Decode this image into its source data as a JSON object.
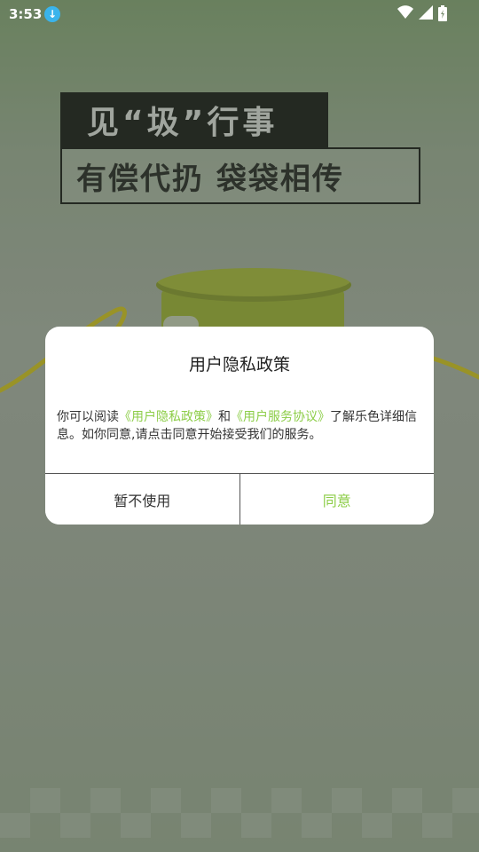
{
  "status_bar": {
    "time": "3:53"
  },
  "background": {
    "slogan_line1": "见“圾”行事",
    "slogan_line2": "有偿代扔 袋袋相传"
  },
  "dialog": {
    "title": "用户隐私政策",
    "body_prefix": "你可以阅读",
    "privacy_link": "《用户隐私政策》",
    "body_and": "和",
    "service_link": "《用户服务协议》",
    "body_suffix": "了解乐色详细信息。如你同意,请点击同意开始接受我们的服务。",
    "cancel_label": "暂不使用",
    "agree_label": "同意"
  },
  "colors": {
    "accent": "#8ccd47"
  }
}
